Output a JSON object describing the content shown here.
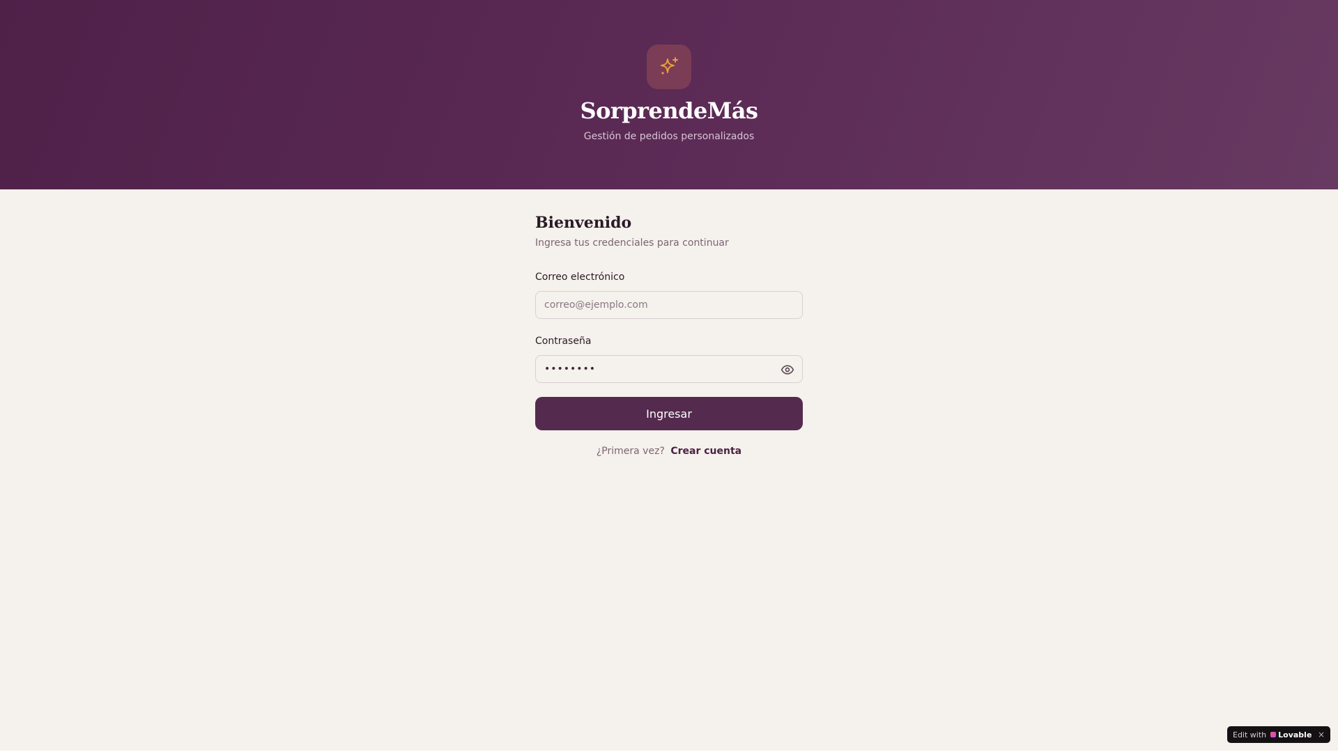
{
  "brand": {
    "name": "SorprendeMás",
    "tagline": "Gestión de pedidos personalizados",
    "logo_icon": "sparkles-icon",
    "accent_color": "#e8a03a"
  },
  "login": {
    "title": "Bienvenido",
    "subtitle": "Ingresa tus credenciales para continuar",
    "email_label": "Correo electrónico",
    "email_placeholder": "correo@ejemplo.com",
    "email_value": "",
    "password_label": "Contraseña",
    "password_value": "••••••••",
    "password_toggle_icon": "eye-icon",
    "submit_label": "Ingresar",
    "signup_prompt": "¿Primera vez?",
    "signup_link": "Crear cuenta"
  },
  "badge": {
    "prefix": "Edit with",
    "name": "Lovable",
    "close": "×"
  },
  "colors": {
    "hero_start": "#4f2149",
    "hero_end": "#673a62",
    "primary": "#552a4f",
    "background": "#f5f1ec"
  }
}
